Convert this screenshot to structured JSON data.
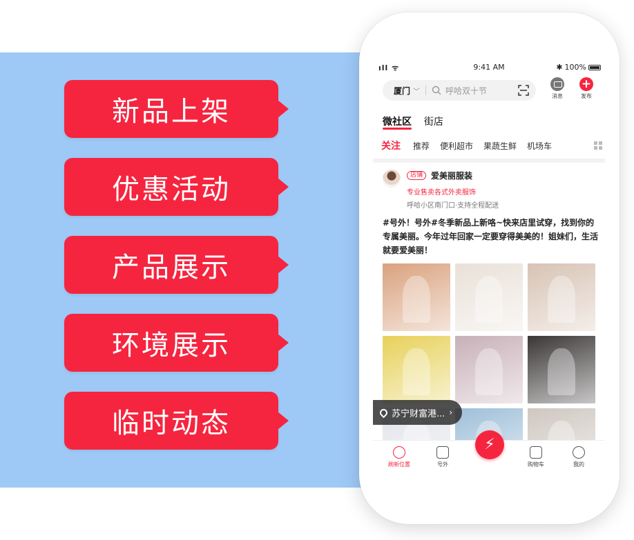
{
  "feature_tags": [
    "新品上架",
    "优惠活动",
    "产品展示",
    "环境展示",
    "临时动态"
  ],
  "status_bar": {
    "signal": "ıll ᯤ",
    "time": "9:41 AM",
    "battery": "100%",
    "bluetooth": "✱"
  },
  "search": {
    "city": "厦门",
    "placeholder": "呼哈双十节"
  },
  "top_actions": {
    "message_label": "消息",
    "post_label": "发布"
  },
  "main_tabs": [
    {
      "label": "微社区",
      "active": true
    },
    {
      "label": "街店",
      "active": false
    }
  ],
  "category_tabs": [
    {
      "label": "关注",
      "active": true
    },
    {
      "label": "推荐",
      "active": false
    },
    {
      "label": "便利超市",
      "active": false
    },
    {
      "label": "果蔬生鲜",
      "active": false
    },
    {
      "label": "机场车",
      "active": false
    }
  ],
  "post": {
    "badge": "店铺",
    "shop_name": "爱美丽服装",
    "description": "专业售卖各式外卖服饰",
    "address": "呼哈小区南门口·支持全程配送",
    "text": "#号外！号外#冬季新品上新咯~快来店里试穿，找到你的专属美丽。今年过年回家一定要穿得美美的！姐妹们，生活就要爱美丽！",
    "photo_colors": [
      "#d9a27e",
      "#e9e1d8",
      "#d7c3b4",
      "#e7d15a",
      "#c8b0b8",
      "#3b3636",
      "#e2e4ea",
      "#9fbfd9",
      "#cfc7c0"
    ]
  },
  "location_pill": {
    "text": "苏宁财富港..."
  },
  "bottom_nav": [
    {
      "label": "刷新位置",
      "active": true
    },
    {
      "label": "号外",
      "active": false
    },
    {
      "label": "",
      "active": false
    },
    {
      "label": "购物车",
      "active": false
    },
    {
      "label": "我的",
      "active": false
    }
  ],
  "colors": {
    "accent": "#f5253f",
    "panel": "#9ec9f7"
  }
}
